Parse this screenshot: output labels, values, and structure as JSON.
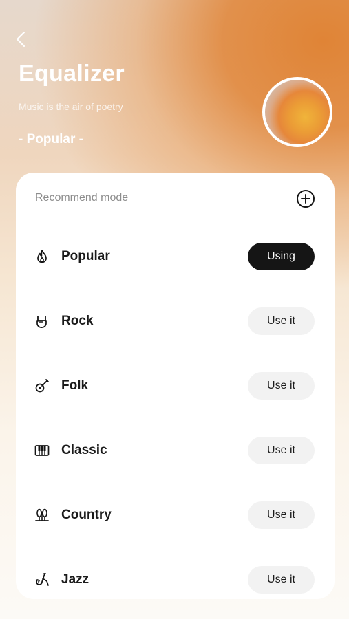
{
  "header": {
    "title": "Equalizer",
    "subtitle": "Music is the air of poetry",
    "current_mode": "- Popular -",
    "back_icon": "chevron-left-icon"
  },
  "card": {
    "heading": "Recommend mode",
    "add_icon": "plus-circle-icon",
    "modes": [
      {
        "name": "Popular",
        "icon": "flame-icon",
        "button": "Using",
        "active": true
      },
      {
        "name": "Rock",
        "icon": "rock-hand-icon",
        "button": "Use it",
        "active": false
      },
      {
        "name": "Folk",
        "icon": "guitar-icon",
        "button": "Use it",
        "active": false
      },
      {
        "name": "Classic",
        "icon": "piano-keys-icon",
        "button": "Use it",
        "active": false
      },
      {
        "name": "Country",
        "icon": "wheat-icon",
        "button": "Use it",
        "active": false
      },
      {
        "name": "Jazz",
        "icon": "saxophone-icon",
        "button": "Use it",
        "active": false
      }
    ]
  },
  "colors": {
    "accent": "#e08436",
    "active_button": "#151515",
    "inactive_button": "#f2f2f2"
  }
}
